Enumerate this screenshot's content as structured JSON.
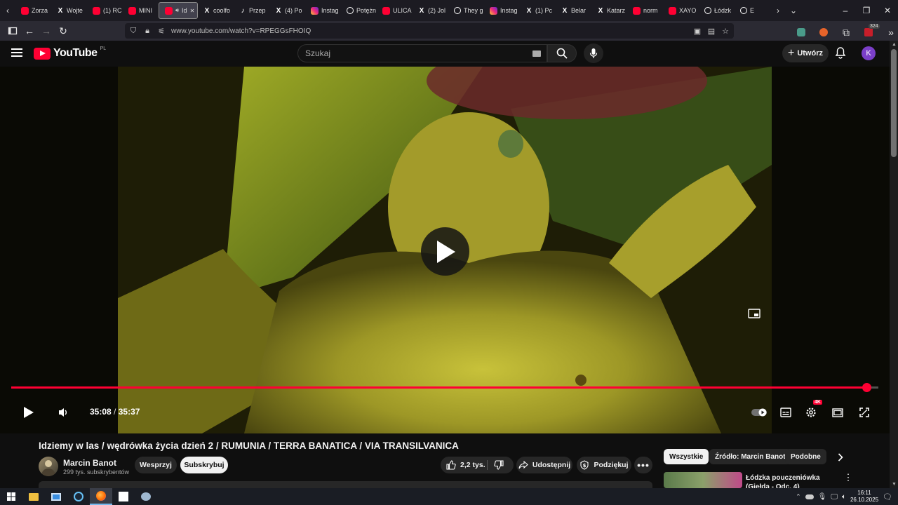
{
  "browser": {
    "tabs": [
      {
        "label": "Zorza",
        "icon": "yt-icon"
      },
      {
        "label": "Wojte",
        "icon": "x-icon"
      },
      {
        "label": "(1) RC",
        "icon": "yt-icon"
      },
      {
        "label": "MINI",
        "icon": "yt-icon"
      },
      {
        "label": "Id",
        "icon": "yt-icon",
        "active": true
      },
      {
        "label": "coolfo",
        "icon": "x-icon"
      },
      {
        "label": "Przep",
        "icon": "tiktok-icon"
      },
      {
        "label": "(4) Po",
        "icon": "x-icon"
      },
      {
        "label": "Instag",
        "icon": "instagram-icon"
      },
      {
        "label": "Potężn",
        "icon": "threads-icon"
      },
      {
        "label": "ULICA",
        "icon": "yt-icon"
      },
      {
        "label": "(2) Jol",
        "icon": "x-icon"
      },
      {
        "label": "They g",
        "icon": "threads-icon"
      },
      {
        "label": "Instag",
        "icon": "instagram-icon"
      },
      {
        "label": "(1) Pc",
        "icon": "x-icon"
      },
      {
        "label": "Belar",
        "icon": "x-icon"
      },
      {
        "label": "Katarz",
        "icon": "x-icon"
      },
      {
        "label": "norm",
        "icon": "yt-icon"
      },
      {
        "label": "XAYO",
        "icon": "yt-icon"
      },
      {
        "label": "Łódzk",
        "icon": "threads-icon"
      },
      {
        "label": "E",
        "icon": "threads-icon"
      }
    ],
    "url": "www.youtube.com/watch?v=RPEGGsFHOIQ",
    "extension_badge": "324"
  },
  "youtube": {
    "logo_text": "YouTube",
    "country_code": "PL",
    "search_placeholder": "Szukaj",
    "create_label": "Utwórz",
    "avatar_letter": "K",
    "avatar_color": "#7b3fc9",
    "accent_color": "#ff0033"
  },
  "player": {
    "current_time": "35:08",
    "separator": "/",
    "duration": "35:37",
    "progress_fraction": 0.9864,
    "quality_badge": "4K",
    "state": "paused"
  },
  "video": {
    "title": "Idziemy w las / wędrówka życia dzień 2 / RUMUNIA / TERRA BANATICA / VIA TRANSILVANICA",
    "channel_name": "Marcin Banot",
    "subscribers": "299 tys. subskrybentów",
    "support_label": "Wesprzyj",
    "subscribe_label": "Subskrybuj",
    "likes": "2,2 tys.",
    "share_label": "Udostępnij",
    "thanks_label": "Podziękuj"
  },
  "sidebar": {
    "chips": [
      "Wszystkie",
      "Źródło: Marcin Banot",
      "Podobne"
    ],
    "related": [
      {
        "title": "Łódzka pouczeniówka (Giełda - Odc. 4)"
      }
    ]
  },
  "taskbar": {
    "time": "16:11",
    "date": "26.10.2025"
  }
}
